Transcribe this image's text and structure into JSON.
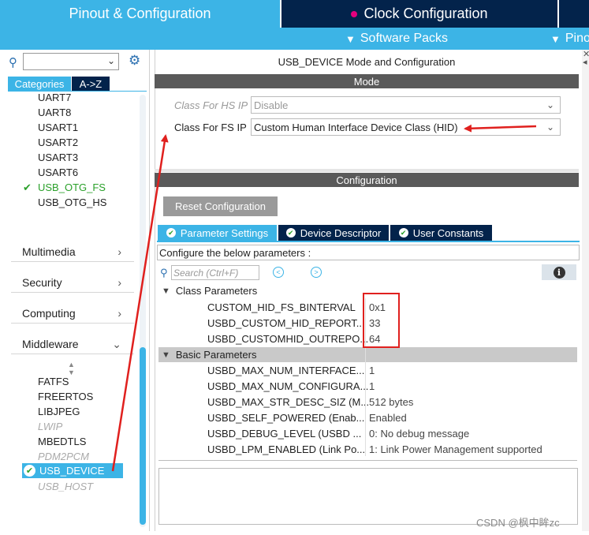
{
  "tabs": {
    "pinout": "Pinout & Configuration",
    "clock": "Clock Configuration"
  },
  "subbar": {
    "software_packs": "Software Packs",
    "pinout_menu": "Pino"
  },
  "sidebar": {
    "tab_categories": "Categories",
    "tab_az": "A->Z",
    "items_top": [
      "UART7",
      "UART8",
      "USART1",
      "USART2",
      "USART3",
      "USART6",
      "USB_OTG_FS",
      "USB_OTG_HS"
    ],
    "categories": [
      "Multimedia",
      "Security",
      "Computing",
      "Middleware"
    ],
    "middleware_items": [
      "FATFS",
      "FREERTOS",
      "LIBJPEG",
      "LWIP",
      "MBEDTLS",
      "PDM2PCM",
      "USB_DEVICE",
      "USB_HOST"
    ]
  },
  "main": {
    "title": "USB_DEVICE Mode and Configuration",
    "mode_header": "Mode",
    "hs_label": "Class For HS IP",
    "hs_value": "Disable",
    "fs_label": "Class For FS IP",
    "fs_value": "Custom Human Interface Device Class (HID)",
    "config_header": "Configuration",
    "reset_button": "Reset Configuration",
    "tabs": [
      "Parameter Settings",
      "Device Descriptor",
      "User Constants"
    ],
    "hint": "Configure the below parameters :",
    "search_placeholder": "Search (Ctrl+F)"
  },
  "class_parameters": {
    "label": "Class Parameters",
    "rows": [
      {
        "name": "CUSTOM_HID_FS_BINTERVAL",
        "value": "0x1"
      },
      {
        "name": "USBD_CUSTOM_HID_REPORT...",
        "value": "33"
      },
      {
        "name": "USBD_CUSTOMHID_OUTREPO...",
        "value": "64"
      }
    ]
  },
  "basic_parameters": {
    "label": "Basic Parameters",
    "rows": [
      {
        "name": "USBD_MAX_NUM_INTERFACE...",
        "value": "1"
      },
      {
        "name": "USBD_MAX_NUM_CONFIGURA...",
        "value": "1"
      },
      {
        "name": "USBD_MAX_STR_DESC_SIZ (M...",
        "value": "512 bytes"
      },
      {
        "name": "USBD_SELF_POWERED (Enab...",
        "value": "Enabled"
      },
      {
        "name": "USBD_DEBUG_LEVEL (USBD ...",
        "value": "0: No debug message"
      },
      {
        "name": "USBD_LPM_ENABLED (Link Po...",
        "value": "1: Link Power Management supported"
      }
    ]
  },
  "watermark": "CSDN @枫中眸zc",
  "colors": {
    "accent": "#3cb4e6",
    "dark_navy": "#03234b",
    "annotation_red": "#e0201e",
    "enabled_green": "#2aa02a"
  }
}
